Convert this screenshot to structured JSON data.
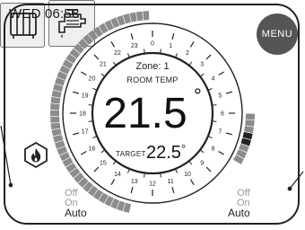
{
  "status_bar": {
    "clock": "WED 06:58"
  },
  "menu": {
    "label": "MENU"
  },
  "thermostat": {
    "zone_label": "Zone: 1",
    "room_temp_label": "ROOM TEMP",
    "room_temp_value": "21.5",
    "degree_symbol": "°",
    "target_label": "TARGET",
    "target_value": "22.5",
    "hour_labels": [
      "0",
      "1",
      "2",
      "3",
      "4",
      "5",
      "6",
      "7",
      "8",
      "9",
      "10",
      "11",
      "12",
      "13",
      "14",
      "15",
      "16",
      "17",
      "18",
      "19",
      "20",
      "21",
      "22",
      "23"
    ],
    "heating_schedule_range": "18:00–24:00",
    "water_schedule_range": "06:00–08:00",
    "current_time_hour": 6.97
  },
  "heating": {
    "icon": "radiator-icon",
    "badge_icon": "flame-icon",
    "modes": {
      "off": "Off",
      "on": "On",
      "auto": "Auto"
    },
    "selected_mode": "Auto"
  },
  "hot_water": {
    "icon": "tap-icon",
    "modes": {
      "off": "Off",
      "on": "On",
      "auto": "Auto"
    },
    "selected_mode": "Auto"
  },
  "colors": {
    "frame": "#222222",
    "menu_button": "#555555",
    "schedule_block": "#8c8c8c",
    "current_block": "#222222",
    "inactive_mode": "#9a9a9a"
  }
}
